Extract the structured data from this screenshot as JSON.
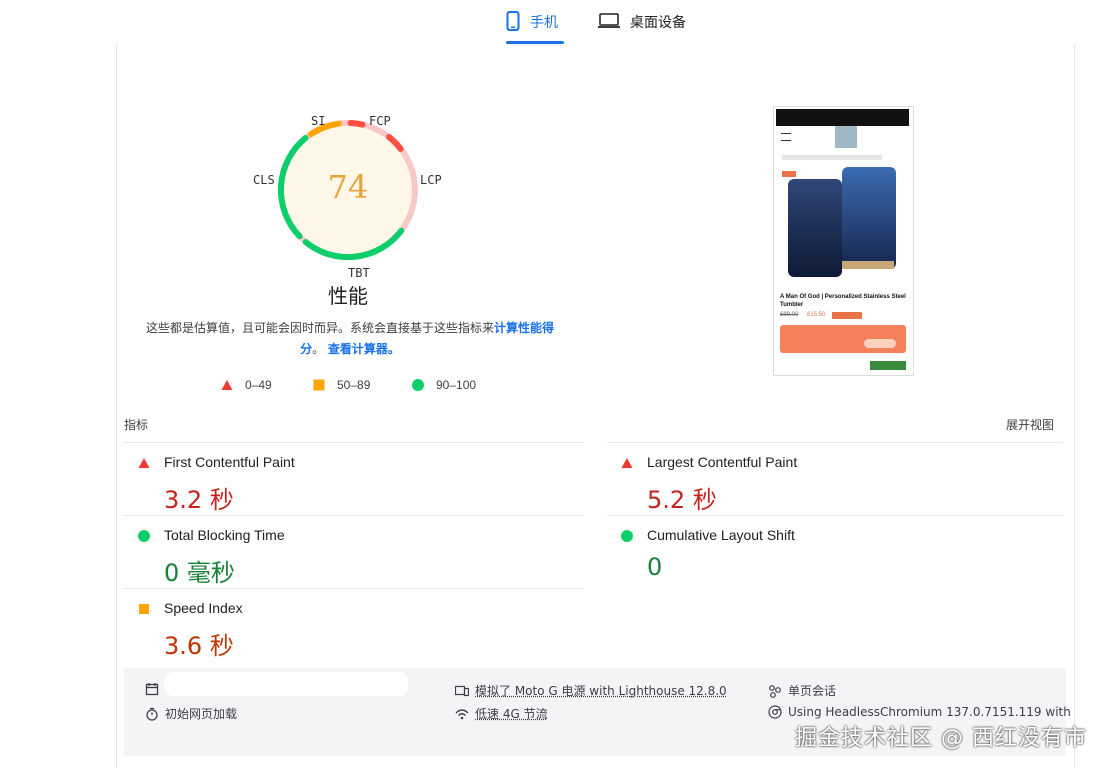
{
  "tabs": [
    {
      "label": "手机",
      "active": true
    },
    {
      "label": "桌面设备",
      "active": false
    }
  ],
  "gauge": {
    "score": "74",
    "labels": {
      "si": "SI",
      "fcp": "FCP",
      "lcp": "LCP",
      "tbt": "TBT",
      "cls": "CLS"
    },
    "title": "性能",
    "colors": {
      "good": "#0cce6b",
      "average": "#ffa400",
      "poor": "#ff4e42",
      "score": "#e8a33c"
    }
  },
  "description": {
    "text": "这些都是估算值，且可能会因时而异。系统会直接基于这些指标来",
    "link1": "计算性能得分",
    "mid": "。",
    "link2": "查看计算器。"
  },
  "legend": [
    {
      "shape": "triangle",
      "range": "0–49"
    },
    {
      "shape": "square",
      "range": "50–89"
    },
    {
      "shape": "circle",
      "range": "90–100"
    }
  ],
  "metrics_header": {
    "label": "指标",
    "expand": "展开视图"
  },
  "metrics": [
    {
      "name": "First Contentful Paint",
      "value": "3.2 秒",
      "status": "poor"
    },
    {
      "name": "Largest Contentful Paint",
      "value": "5.2 秒",
      "status": "poor"
    },
    {
      "name": "Total Blocking Time",
      "value": "0 毫秒",
      "status": "good"
    },
    {
      "name": "Cumulative Layout Shift",
      "value": "0",
      "status": "good"
    },
    {
      "name": "Speed Index",
      "value": "3.6 秒",
      "status": "average"
    }
  ],
  "info": {
    "initial_load": "初始网页加载",
    "emulated": "模拟了 Moto G 电源 with Lighthouse 12.8.0",
    "throttling": "低速 4G 节流",
    "session": "单页会话",
    "browser": "Using HeadlessChromium 137.0.7151.119 with"
  },
  "thumbnail": {
    "product_title": "A Man Of God | Personalized Stainless Steel Tumbler",
    "old_price": "£99.00",
    "new_price": "£15.50"
  },
  "watermark": "掘金技术社区 @ 西红没有市"
}
